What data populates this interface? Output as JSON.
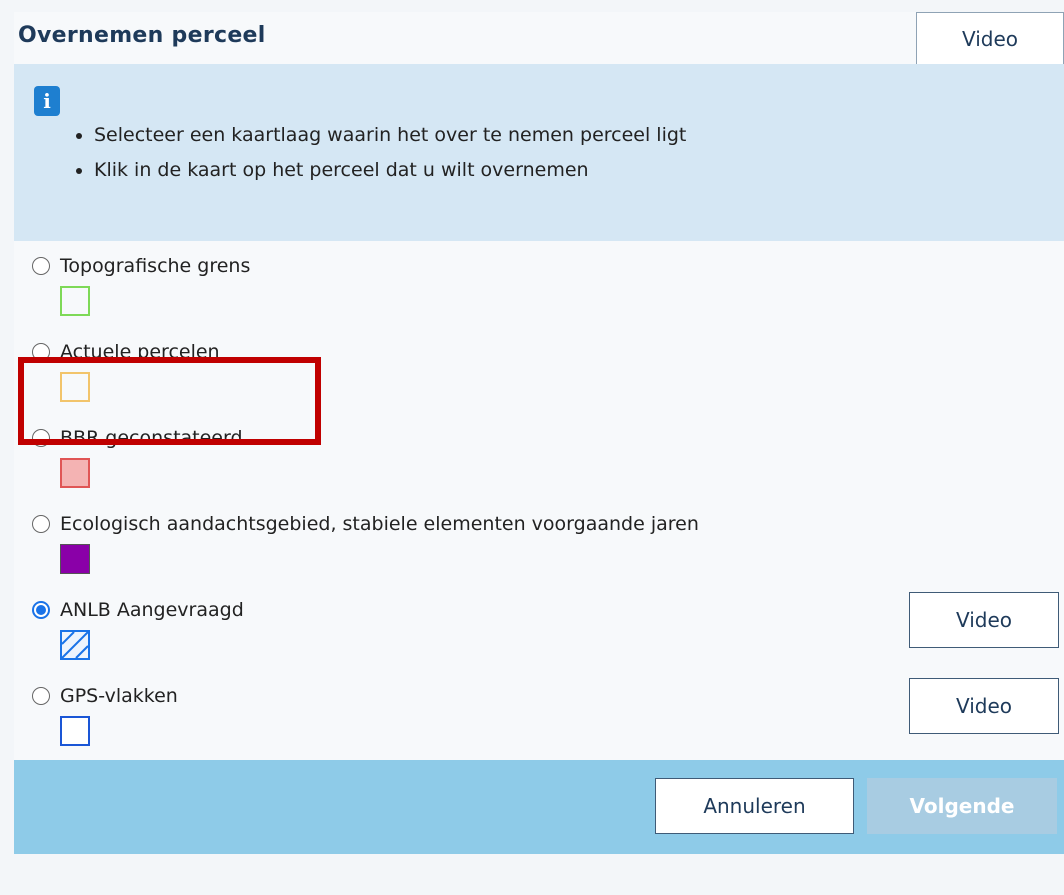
{
  "header": {
    "title": "Overnemen perceel",
    "video_label": "Video"
  },
  "info": {
    "icon": "info-icon",
    "icon_glyph": "i",
    "bullets": [
      "Selecteer een kaartlaag waarin het over te nemen perceel ligt",
      "Klik in de kaart op het perceel dat u wilt overnemen"
    ]
  },
  "options": [
    {
      "label": "Topografische grens",
      "checked": false,
      "swatch": {
        "style": "outline",
        "color": "#7ed957"
      },
      "video": null
    },
    {
      "label": "Actuele percelen",
      "checked": false,
      "swatch": {
        "style": "outline",
        "color": "#f2c46b"
      },
      "video": null
    },
    {
      "label": "BBR geconstateerd",
      "checked": false,
      "swatch": {
        "style": "filled",
        "color": "#f4b3b3",
        "border": "#e05555"
      },
      "video": null
    },
    {
      "label": "Ecologisch aandachtsgebied, stabiele elementen voorgaande jaren",
      "checked": false,
      "swatch": {
        "style": "filled",
        "color": "#8a00a8",
        "border": "#555555"
      },
      "video": null
    },
    {
      "label": "ANLB Aangevraagd",
      "checked": true,
      "swatch": {
        "style": "hatched",
        "color": "#1a73e8"
      },
      "video": "Video"
    },
    {
      "label": "GPS-vlakken",
      "checked": false,
      "swatch": {
        "style": "outline",
        "color": "#1a56d6"
      },
      "video": "Video"
    }
  ],
  "footer": {
    "cancel_label": "Annuleren",
    "next_label": "Volgende",
    "next_enabled": false
  },
  "colors": {
    "info_bg": "#d5e7f4",
    "footer_bg": "#8ecbe8",
    "highlight": "#c00000",
    "title": "#1e3a5a"
  }
}
